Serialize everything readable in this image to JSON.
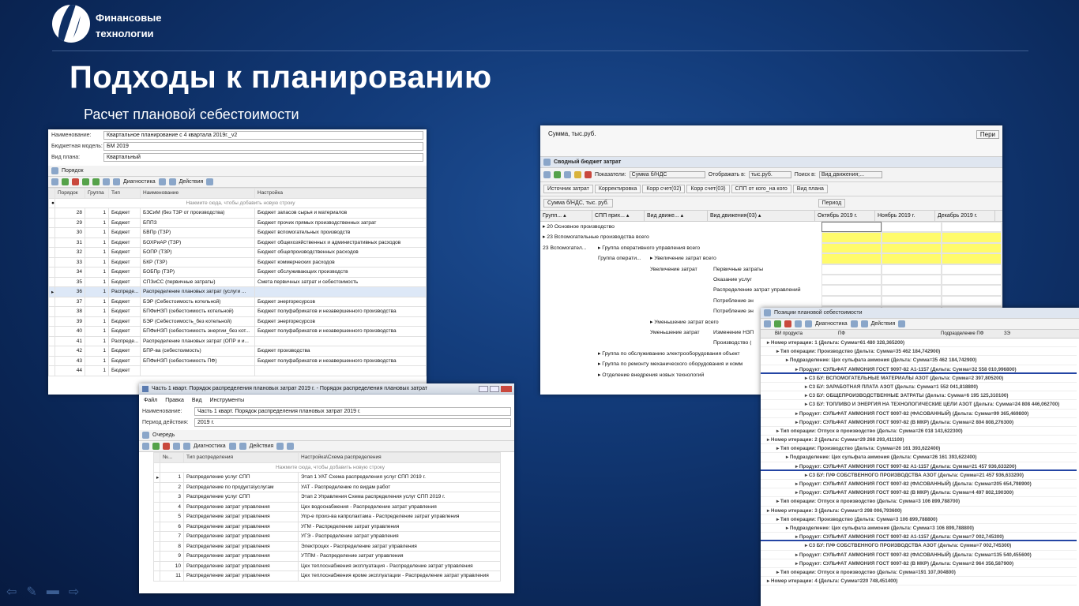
{
  "brand": {
    "line1": "Финансовые",
    "line2": "технологии"
  },
  "title": "Подходы к планированию",
  "subtitle": "Расчет плановой себестоимости",
  "w1": {
    "fields": [
      {
        "k": "Наименование:",
        "v": "Квартальное планирование с 4 квартала 2019г._v2"
      },
      {
        "k": "Бюджетная модель:",
        "v": "БМ 2019"
      },
      {
        "k": "Вид плана:",
        "v": "Квартальный"
      }
    ],
    "panel": "Порядок",
    "diag": "Диагностика",
    "actions": "Действия",
    "cols": [
      "Порядок",
      "Группа",
      "Тип",
      "Наименование",
      "Настройка"
    ],
    "newrow": "Нажмите сюда, чтобы добавить новую строку",
    "rows": [
      [
        "28",
        "1",
        "Бюджет",
        "БЗСиМ (без ТЗР от производства)",
        "Бюджет запасов сырья и материалов"
      ],
      [
        "29",
        "1",
        "Бюджет",
        "БППЗ",
        "Бюджет прочих прямых производственных затрат"
      ],
      [
        "30",
        "1",
        "Бюджет",
        "БВПр (ТЗР)",
        "Бюджет вспомогательных производств"
      ],
      [
        "31",
        "1",
        "Бюджет",
        "БОХРиАР (ТЗР)",
        "Бюджет общехозяйственных и административных расходов"
      ],
      [
        "32",
        "1",
        "Бюджет",
        "БОПР (ТЗР)",
        "Бюджет общепроизводственных расходов"
      ],
      [
        "33",
        "1",
        "Бюджет",
        "БКР (ТЗР)",
        "Бюджет коммерческих расходов"
      ],
      [
        "34",
        "1",
        "Бюджет",
        "БОБПр (ТЗР)",
        "Бюджет обслуживающих производств"
      ],
      [
        "35",
        "1",
        "Бюджет",
        "СПЗиСС (первичные затраты)",
        "Смета первичных затрат и себестоимость"
      ],
      [
        "36",
        "1",
        "Распреде...",
        "Распределение плановых затрат (услуги ...",
        ""
      ],
      [
        "37",
        "1",
        "Бюджет",
        "БЭР (Себестоимость котельной)",
        "Бюджет энергоресурсов"
      ],
      [
        "38",
        "1",
        "Бюджет",
        "БПФиНЗП (себестоимость котельной)",
        "Бюджет полуфабрикатов и незавершенного производства"
      ],
      [
        "39",
        "1",
        "Бюджет",
        "БЭР (Себестоимость_без котельной)",
        "Бюджет энергоресурсов"
      ],
      [
        "40",
        "1",
        "Бюджет",
        "БПФиНЗП (себестоимость энергии_без кот...",
        "Бюджет полуфабрикатов и незавершенного производства"
      ],
      [
        "41",
        "1",
        "Распреде...",
        "Распределение плановых затрат (ОПР и и...",
        ""
      ],
      [
        "42",
        "1",
        "Бюджет",
        "БПР-ва (себестоимость)",
        "Бюджет производства"
      ],
      [
        "43",
        "1",
        "Бюджет",
        "БПФиНЗП (себестоимость ПФ)",
        "Бюджет полуфабрикатов и незавершенного производства"
      ],
      [
        "44",
        "1",
        "Бюджет",
        "",
        ""
      ]
    ]
  },
  "w2": {
    "title": "Часть 1 кварт. Порядок распределения плановых затрат 2019 г. - Порядок распределения плановых затрат",
    "menu": [
      "Файл",
      "Правка",
      "Вид",
      "Инструменты"
    ],
    "fields": [
      {
        "k": "Наименование:",
        "v": "Часть 1 кварт. Порядок распределения плановых затрат 2019 г."
      },
      {
        "k": "Период действия:",
        "v": "2019 г."
      }
    ],
    "panel": "Очередь",
    "diag": "Диагностика",
    "actions": "Действия",
    "cols": [
      "№...",
      "Тип распределения",
      "Настройка\\Схема распределения"
    ],
    "newrow": "Нажмите сюда, чтобы добавить новую строку",
    "rows": [
      [
        "1",
        "Распределение услуг СПП",
        "Этап 1 УАТ Схема распределения услуг СПП 2019 г."
      ],
      [
        "2",
        "Распределение по продукта\\услугам",
        "УАТ - Распределение по видам работ"
      ],
      [
        "3",
        "Распределение услуг СПП",
        "Этап 2 Управления Схема распределения услуг СПП 2019 г."
      ],
      [
        "4",
        "Распределение затрат управления",
        "Цех водоснабжения - Распределение затрат управления"
      ],
      [
        "5",
        "Распределение затрат управления",
        "Упр-е произ-ва капролактама - Распределение затрат управления"
      ],
      [
        "6",
        "Распределение затрат управления",
        "УГМ - Распределение затрат управления"
      ],
      [
        "7",
        "Распределение затрат управления",
        "УГЭ - Распределение затрат управления"
      ],
      [
        "8",
        "Распределение затрат управления",
        "Электроцех - Распределение затрат управления"
      ],
      [
        "9",
        "Распределение затрат управления",
        "УТПМ - Распределение затрат управления"
      ],
      [
        "10",
        "Распределение затрат управления",
        "Цех теплоснабжения эксплуатация - Распределение затрат управления"
      ],
      [
        "11",
        "Распределение затрат управления",
        "Цех теплоснабжения кроме эксплуатации - Распределение затрат управления"
      ]
    ]
  },
  "w3": {
    "top": "Сумма, тыс.руб.",
    "top2": "Пери",
    "title": "Сводный бюджет затрат",
    "show": "Показатели:",
    "showv": "Сумма б/НДС",
    "disp": "Отображать в:",
    "dispv": "тыс.руб.",
    "search": "Поиск в:",
    "searchv": "Вид движения;...",
    "btns": [
      "Источник затрат",
      "Корректировка",
      "Корр счет(02)",
      "Корр счет(03)",
      "СПП от кого_на кого",
      "Вид плана"
    ],
    "sum": "Сумма б/НДС, тыс. руб.",
    "period": "Период",
    "hdrs": [
      "Групп...",
      "СПП прих...",
      "Вид движе...",
      "Вид движения(03)"
    ],
    "months": [
      "Октябрь 2019 г.",
      "Ноябрь 2019 г.",
      "Декабрь 2019 г."
    ],
    "tree": [
      "20 Основное производство",
      "23 Вспомогательные производства всего",
      "23 Вспомогател...",
      "Группа оперативного управления всего",
      "Группа операти...",
      "Увеличение затрат всего",
      "Увеличение затрат",
      "Первичные затраты",
      "Оказание услуг",
      "Распределение затрат управлений",
      "Потребление эн",
      "Потребление эн",
      "Уменьшение затрат всего",
      "Уменьшение затрат",
      "Изменение НЗП",
      "Производство (",
      "Группа по обслуживанию электрооборудования объект",
      "Группа по ремонту механического оборудования и комм",
      "Отделение внедрения новых технологий"
    ]
  },
  "w4": {
    "title": "Позиции плановой себестоимости",
    "diag": "Диагностика",
    "actions": "Действия",
    "cols": [
      "ВИ продукта",
      "ПФ",
      "Подразделение ПФ",
      "ЗЭ"
    ],
    "rows": [
      "Номер итерации: 1 (Дельта: Сумма=61 480 328,365200)",
      "Тип операции: Производство (Дельта: Сумма=35 462 184,742900)",
      "Подразделение: Цех сульфата аммония (Дельта: Сумма=35 462 184,742900)",
      "Продукт: СУЛЬФАТ АММОНИЯ ГОСТ 9097-82 А1-1157 (Дельта: Сумма=32 558 010,996800)",
      "С3 БУ: ВСПОМОГАТЕЛЬНЫЕ МАТЕРИАЛЫ АЗОТ (Дельта: Сумма=2 397,805200)",
      "С3 БУ: ЗАРАБОТНАЯ ПЛАТА АЗОТ (Дельта: Сумма=1 552 041,818800)",
      "С3 БУ: ОБЩЕПРОИЗВОДСТВЕННЫЕ ЗАТРАТЫ (Дельта: Сумма=6 195 125,310100)",
      "С3 БУ: ТОПЛИВО И ЭНЕРГИЯ НА ТЕХНОЛОГИЧЕСКИЕ ЦЕЛИ АЗОТ (Дельта: Сумма=24 808 446,062700)",
      "Продукт: СУЛЬФАТ АММОНИЯ ГОСТ 9097-82 (ФАСОВАННЫЙ) (Дельта: Сумма=99 365,469800)",
      "Продукт: СУЛЬФАТ АММОНИЯ ГОСТ 9097-82 (В МКР) (Дельта: Сумма=2 804 808,276300)",
      "Тип операции: Отпуск в производство (Дельта: Сумма=26 018 143,622300)",
      "Номер итерации: 2 (Дельта: Сумма=29 268 293,411100)",
      "Тип операции: Производство (Дельта: Сумма=26 161 393,622400)",
      "Подразделение: Цех сульфата аммония (Дельта: Сумма=26 161 393,622400)",
      "Продукт: СУЛЬФАТ АММОНИЯ ГОСТ 9097-82 А1-1157 (Дельта: Сумма=21 457 936,633200)",
      "С3 БУ: П/Ф СОБСТВЕННОГО ПРОИЗВОДСТВА АЗОТ (Дельта: Сумма=21 457 936,633200)",
      "Продукт: СУЛЬФАТ АММОНИЯ ГОСТ 9097-82 (ФАСОВАННЫЙ) (Дельта: Сумма=205 654,798900)",
      "Продукт: СУЛЬФАТ АММОНИЯ ГОСТ 9097-82 (В МКР) (Дельта: Сумма=4 497 802,190300)",
      "Тип операции: Отпуск в производство (Дельта: Сумма=3 106 899,788700)",
      "Номер итерации: 3 (Дельта: Сумма=3 298 006,793600)",
      "Тип операции: Производство (Дельта: Сумма=3 106 899,788800)",
      "Подразделение: Цех сульфата аммония (Дельта: Сумма=3 106 899,788800)",
      "Продукт: СУЛЬФАТ АММОНИЯ ГОСТ 9097-82 А1-1157 (Дельта: Сумма=7 002,745300)",
      "С3 БУ: П/Ф СОБСТВЕННОГО ПРОИЗВОДСТВА АЗОТ (Дельта: Сумма=7 002,745300)",
      "Продукт: СУЛЬФАТ АММОНИЯ ГОСТ 9097-82 (ФАСОВАННЫЙ) (Дельта: Сумма=135 540,455600)",
      "Продукт: СУЛЬФАТ АММОНИЯ ГОСТ 9097-82 (В МКР) (Дельта: Сумма=2 964 356,587900)",
      "Тип операции: Отпуск в производство (Дельта: Сумма=191 107,004800)",
      "Номер итерации: 4 (Дельта: Сумма=220 748,451400)"
    ]
  }
}
